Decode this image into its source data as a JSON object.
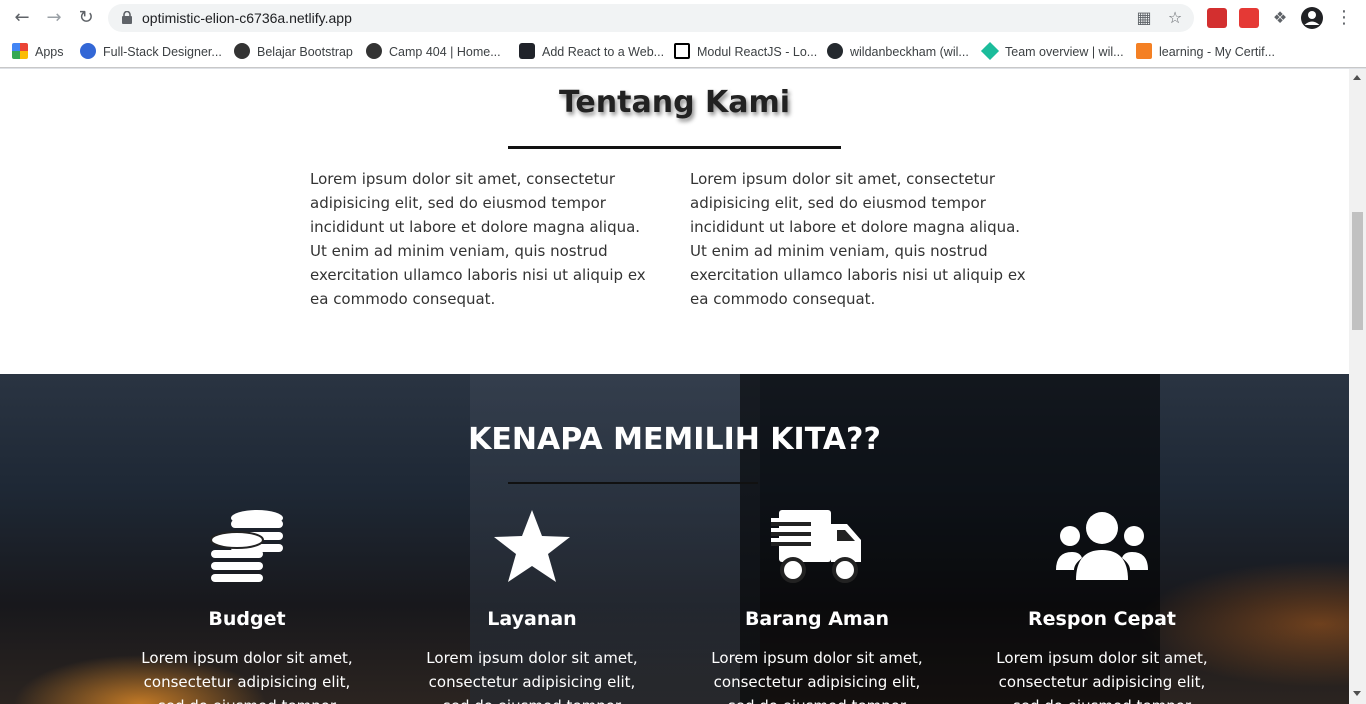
{
  "browser": {
    "url": "optimistic-elion-c6736a.netlify.app",
    "bookmarks": [
      {
        "label": "Apps",
        "icon": "apps-grid-icon"
      },
      {
        "label": "Full-Stack Designer...",
        "icon": "bookmark-icon"
      },
      {
        "label": "Belajar Bootstrap",
        "icon": "globe-icon"
      },
      {
        "label": "Camp 404 | Home...",
        "icon": "globe-icon"
      },
      {
        "label": "Add React to a Web...",
        "icon": "react-icon"
      },
      {
        "label": "Modul ReactJS - Lo...",
        "icon": "notion-icon"
      },
      {
        "label": "wildanbeckham (wil...",
        "icon": "github-icon"
      },
      {
        "label": "Team overview | wil...",
        "icon": "diamond-icon"
      },
      {
        "label": "learning - My Certif...",
        "icon": "code-bracket-icon"
      }
    ]
  },
  "about": {
    "title": "Tentang Kami",
    "col1": "Lorem ipsum dolor sit amet, consectetur adipisicing elit, sed do eiusmod tempor incididunt ut labore et dolore magna aliqua. Ut enim ad minim veniam, quis nostrud exercitation ullamco laboris nisi ut aliquip ex ea commodo consequat.",
    "col2": "Lorem ipsum dolor sit amet, consectetur adipisicing elit, sed do eiusmod tempor incididunt ut labore et dolore magna aliqua. Ut enim ad minim veniam, quis nostrud exercitation ullamco laboris nisi ut aliquip ex ea commodo consequat."
  },
  "why": {
    "title": "KENAPA MEMILIH KITA??",
    "features": [
      {
        "title": "Budget",
        "icon": "coins-icon",
        "text": "Lorem ipsum dolor sit amet, consectetur adipisicing elit, sed do eiusmod tempor"
      },
      {
        "title": "Layanan",
        "icon": "star-icon",
        "text": "Lorem ipsum dolor sit amet, consectetur adipisicing elit, sed do eiusmod tempor"
      },
      {
        "title": "Barang Aman",
        "icon": "shipping-truck-icon",
        "text": "Lorem ipsum dolor sit amet, consectetur adipisicing elit, sed do eiusmod tempor"
      },
      {
        "title": "Respon Cepat",
        "icon": "users-group-icon",
        "text": "Lorem ipsum dolor sit amet, consectetur adipisicing elit, sed do eiusmod tempor"
      }
    ]
  }
}
